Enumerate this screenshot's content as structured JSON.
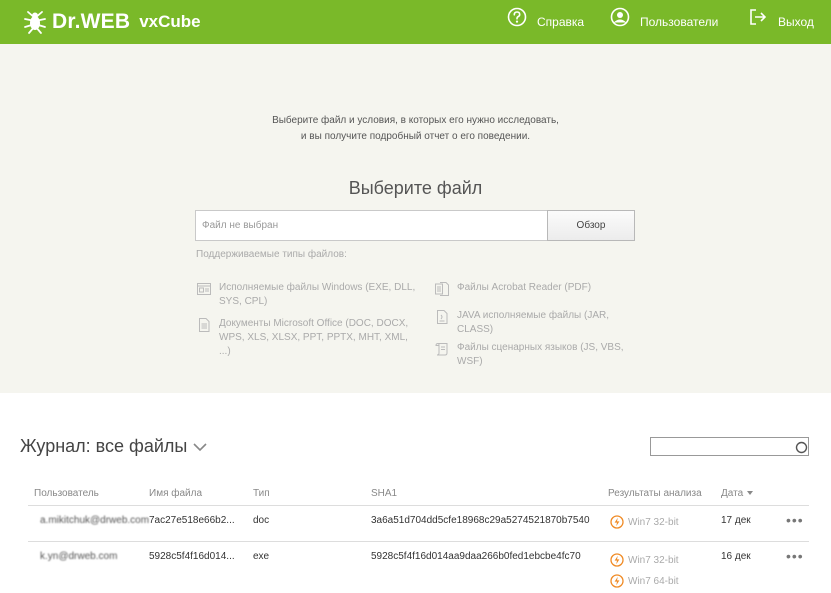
{
  "header": {
    "brand": "Dr.WEB",
    "product": "vxCube",
    "nav": {
      "help": "Справка",
      "users": "Пользователи",
      "exit": "Выход"
    }
  },
  "upload": {
    "intro_line1": "Выберите файл и условия, в которых его нужно исследовать,",
    "intro_line2": "и вы получите подробный отчет о его поведении.",
    "title": "Выберите файл",
    "file_placeholder": "Файл не выбран",
    "browse_label": "Обзор",
    "supported_label": "Поддерживаемые типы файлов:",
    "file_types": [
      {
        "label": "Исполняемые файлы Windows (EXE, DLL, SYS, CPL)",
        "icon": "windows-executable-icon"
      },
      {
        "label": "Документы Microsoft Office (DOC, DOCX, WPS, XLS, XLSX, PPT, PPTX, MHT, XML, ...)",
        "icon": "office-document-icon"
      },
      {
        "label": "Файлы Acrobat Reader (PDF)",
        "icon": "pdf-icon"
      },
      {
        "label": "JAVA исполняемые файлы (JAR, CLASS)",
        "icon": "java-icon"
      },
      {
        "label": "Файлы сценарных языков (JS, VBS, WSF)",
        "icon": "script-icon"
      }
    ]
  },
  "journal": {
    "title": "Журнал: все файлы",
    "columns": {
      "user": "Пользователь",
      "filename": "Имя файла",
      "type": "Тип",
      "sha1": "SHA1",
      "results": "Результаты анализа",
      "date": "Дата"
    },
    "rows": [
      {
        "user": "a.mikitchuk@drweb.com",
        "filename": "7ac27e518e66b2...",
        "type": "doc",
        "sha1": "3a6a51d704dd5cfe18968c29a5274521870b7540",
        "results": [
          "Win7 32-bit"
        ],
        "date": "17 дек",
        "more": "•••"
      },
      {
        "user": "k.yn@drweb.com",
        "filename": "5928c5f4f16d014...",
        "type": "exe",
        "sha1": "5928c5f4f16d014aa9daa266b0fed1ebcbe4fc70",
        "results": [
          "Win7 32-bit",
          "Win7 64-bit"
        ],
        "date": "16 дек",
        "more": "•••"
      }
    ]
  },
  "colors": {
    "header_green": "#7ab929",
    "upload_bg": "#f5f5ef",
    "result_orange": "#f08a24"
  }
}
